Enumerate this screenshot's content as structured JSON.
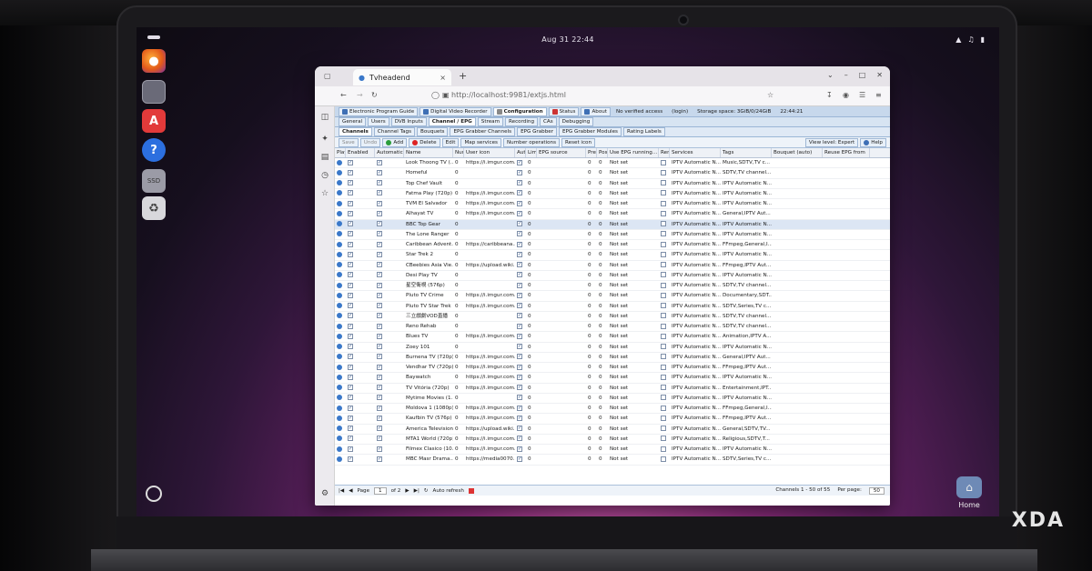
{
  "topbar": {
    "clock": "Aug 31  22:44",
    "tray": [
      "wifi-icon",
      "volume-icon",
      "battery-icon"
    ]
  },
  "dock": {
    "items": [
      "firefox-icon",
      "files-icon",
      "app-center-icon",
      "help-icon",
      "ssd-drive-icon",
      "trash-icon",
      "ubuntu-apps-icon"
    ]
  },
  "browser": {
    "tab_title": "Tvheadend",
    "url": "http://localhost:9981/extjs.html",
    "new_tab": "+",
    "close": "×"
  },
  "tvh": {
    "row1": [
      "Electronic Program Guide",
      "Digital Video Recorder",
      "Configuration",
      "Status",
      "About"
    ],
    "row1_info": [
      "No verified access",
      "(login)",
      "Storage space: 3GiB/0/24GiB",
      "22:44:21"
    ],
    "row2": [
      "General",
      "Users",
      "DVB Inputs",
      "Channel / EPG",
      "Stream",
      "Recording",
      "CAs",
      "Debugging"
    ],
    "row3": [
      "Channels",
      "Channel Tags",
      "Bouquets",
      "EPG Grabber Channels",
      "EPG Grabber",
      "EPG Grabber Modules",
      "Rating Labels"
    ],
    "row4": [
      "Save",
      "Undo",
      "Add",
      "Delete",
      "Edit",
      "Map services",
      "Number operations",
      "Reset icon"
    ],
    "view_level": "View level: Expert",
    "help": "Help",
    "columns": [
      "Play",
      "Enabled",
      "Automatic...",
      "Name",
      "Num",
      "User icon",
      "Auto",
      "Limit",
      "EPG source",
      "Pre",
      "Post",
      "Use EPG running...",
      "Rem",
      "Services",
      "Tags",
      "Bouquet (auto)",
      "Reuse EPG from"
    ]
  },
  "rows": [
    {
      "name": "Look Thoong TV (...",
      "num": "0",
      "icon": "https://i.imgur.com...",
      "epg": "Not set",
      "svc": "IPTV Automatic N...",
      "tags": "Music,SDTV,TV c..."
    },
    {
      "name": "Homeful",
      "num": "0",
      "icon": "",
      "epg": "Not set",
      "svc": "IPTV Automatic N...",
      "tags": "SDTV,TV channel..."
    },
    {
      "name": "Top Chef Vault",
      "num": "0",
      "icon": "",
      "epg": "Not set",
      "svc": "IPTV Automatic N...",
      "tags": "IPTV Automatic N..."
    },
    {
      "name": "Fatma Play (720p)",
      "num": "0",
      "icon": "https://i.imgur.com...",
      "epg": "Not set",
      "svc": "IPTV Automatic N...",
      "tags": "IPTV Automatic N..."
    },
    {
      "name": "TVM El Salvador",
      "num": "0",
      "icon": "https://i.imgur.com...",
      "epg": "Not set",
      "svc": "IPTV Automatic N...",
      "tags": "IPTV Automatic N..."
    },
    {
      "name": "Alhayat TV",
      "num": "0",
      "icon": "https://i.imgur.com...",
      "epg": "Not set",
      "svc": "IPTV Automatic N...",
      "tags": "General,IPTV Aut..."
    },
    {
      "name": "BBC Top Gear",
      "num": "0",
      "icon": "",
      "epg": "Not set",
      "svc": "IPTV Automatic N...",
      "tags": "IPTV Automatic N..."
    },
    {
      "name": "The Lone Ranger",
      "num": "0",
      "icon": "",
      "epg": "Not set",
      "svc": "IPTV Automatic N...",
      "tags": "IPTV Automatic N..."
    },
    {
      "name": "Caribbean Advent...",
      "num": "0",
      "icon": "https://caribbeana...",
      "epg": "Not set",
      "svc": "IPTV Automatic N...",
      "tags": "FFmpeg,General,I..."
    },
    {
      "name": "Star Trek 2",
      "num": "0",
      "icon": "",
      "epg": "Not set",
      "svc": "IPTV Automatic N...",
      "tags": "IPTV Automatic N..."
    },
    {
      "name": "CBeebies Asia Vie...",
      "num": "0",
      "icon": "https://upload.wiki...",
      "epg": "Not set",
      "svc": "IPTV Automatic N...",
      "tags": "FFmpeg,IPTV Aut..."
    },
    {
      "name": "Desi Play TV",
      "num": "0",
      "icon": "",
      "epg": "Not set",
      "svc": "IPTV Automatic N...",
      "tags": "IPTV Automatic N..."
    },
    {
      "name": "星空衛視 (576p)",
      "num": "0",
      "icon": "",
      "epg": "Not set",
      "svc": "IPTV Automatic N...",
      "tags": "SDTV,TV channel..."
    },
    {
      "name": "Pluto TV Crime",
      "num": "0",
      "icon": "https://i.imgur.com...",
      "epg": "Not set",
      "svc": "IPTV Automatic N...",
      "tags": "Documentary,SDT..."
    },
    {
      "name": "Pluto TV Star Trek",
      "num": "0",
      "icon": "https://i.imgur.com...",
      "epg": "Not set",
      "svc": "IPTV Automatic N...",
      "tags": "SDTV,Series,TV c..."
    },
    {
      "name": "三立戲劇VOD直播",
      "num": "0",
      "icon": "",
      "epg": "Not set",
      "svc": "IPTV Automatic N...",
      "tags": "SDTV,TV channel..."
    },
    {
      "name": "Reno Rehab",
      "num": "0",
      "icon": "",
      "epg": "Not set",
      "svc": "IPTV Automatic N...",
      "tags": "SDTV,TV channel..."
    },
    {
      "name": "Blues TV",
      "num": "0",
      "icon": "https://i.imgur.com...",
      "epg": "Not set",
      "svc": "IPTV Automatic N...",
      "tags": "Animation,IPTV A..."
    },
    {
      "name": "Zoey 101",
      "num": "0",
      "icon": "",
      "epg": "Not set",
      "svc": "IPTV Automatic N...",
      "tags": "IPTV Automatic N..."
    },
    {
      "name": "Burnena TV (720p)",
      "num": "0",
      "icon": "https://i.imgur.com...",
      "epg": "Not set",
      "svc": "IPTV Automatic N...",
      "tags": "General,IPTV Aut..."
    },
    {
      "name": "Vendhar TV (720p)",
      "num": "0",
      "icon": "https://i.imgur.com...",
      "epg": "Not set",
      "svc": "IPTV Automatic N...",
      "tags": "FFmpeg,IPTV Aut..."
    },
    {
      "name": "Baywatch",
      "num": "0",
      "icon": "https://i.imgur.com...",
      "epg": "Not set",
      "svc": "IPTV Automatic N...",
      "tags": "IPTV Automatic N..."
    },
    {
      "name": "TV Vitória (720p)",
      "num": "0",
      "icon": "https://i.imgur.com...",
      "epg": "Not set",
      "svc": "IPTV Automatic N...",
      "tags": "Entertainment,IPT..."
    },
    {
      "name": "Mytime Movies (1...",
      "num": "0",
      "icon": "",
      "epg": "Not set",
      "svc": "IPTV Automatic N...",
      "tags": "IPTV Automatic N..."
    },
    {
      "name": "Moldova 1 (1080p)",
      "num": "0",
      "icon": "https://i.imgur.com...",
      "epg": "Not set",
      "svc": "IPTV Automatic N...",
      "tags": "FFmpeg,General,I..."
    },
    {
      "name": "Kaufbin TV (576p)",
      "num": "0",
      "icon": "https://i.imgur.com...",
      "epg": "Not set",
      "svc": "IPTV Automatic N...",
      "tags": "FFmpeg,IPTV Aut..."
    },
    {
      "name": "America Television",
      "num": "0",
      "icon": "https://upload.wiki...",
      "epg": "Not set",
      "svc": "IPTV Automatic N...",
      "tags": "General,SDTV,TV..."
    },
    {
      "name": "MTA1 World (720p)",
      "num": "0",
      "icon": "https://i.imgur.com...",
      "epg": "Not set",
      "svc": "IPTV Automatic N...",
      "tags": "Religious,SDTV,T..."
    },
    {
      "name": "Filmex Clasico (10...",
      "num": "0",
      "icon": "https://i.imgur.com...",
      "epg": "Not set",
      "svc": "IPTV Automatic N...",
      "tags": "IPTV Automatic N..."
    },
    {
      "name": "MBC Masr Drama...",
      "num": "0",
      "icon": "https://media0070...",
      "epg": "Not set",
      "svc": "IPTV Automatic N...",
      "tags": "SDTV,Series,TV c..."
    }
  ],
  "pager": {
    "page_label": "Page",
    "page": "1",
    "of": "of 2",
    "auto_refresh": "Auto refresh",
    "summary": "Channels 1 - 50 of 55",
    "per_page_label": "Per page:",
    "per_page": "50"
  },
  "home": {
    "label": "Home"
  },
  "watermark": "XDA"
}
